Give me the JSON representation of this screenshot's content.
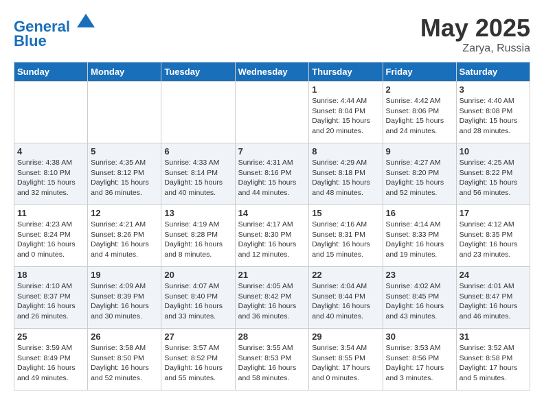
{
  "header": {
    "logo_line1": "General",
    "logo_line2": "Blue",
    "month_year": "May 2025",
    "location": "Zarya, Russia"
  },
  "weekdays": [
    "Sunday",
    "Monday",
    "Tuesday",
    "Wednesday",
    "Thursday",
    "Friday",
    "Saturday"
  ],
  "weeks": [
    [
      {
        "num": "",
        "info": ""
      },
      {
        "num": "",
        "info": ""
      },
      {
        "num": "",
        "info": ""
      },
      {
        "num": "",
        "info": ""
      },
      {
        "num": "1",
        "info": "Sunrise: 4:44 AM\nSunset: 8:04 PM\nDaylight: 15 hours\nand 20 minutes."
      },
      {
        "num": "2",
        "info": "Sunrise: 4:42 AM\nSunset: 8:06 PM\nDaylight: 15 hours\nand 24 minutes."
      },
      {
        "num": "3",
        "info": "Sunrise: 4:40 AM\nSunset: 8:08 PM\nDaylight: 15 hours\nand 28 minutes."
      }
    ],
    [
      {
        "num": "4",
        "info": "Sunrise: 4:38 AM\nSunset: 8:10 PM\nDaylight: 15 hours\nand 32 minutes."
      },
      {
        "num": "5",
        "info": "Sunrise: 4:35 AM\nSunset: 8:12 PM\nDaylight: 15 hours\nand 36 minutes."
      },
      {
        "num": "6",
        "info": "Sunrise: 4:33 AM\nSunset: 8:14 PM\nDaylight: 15 hours\nand 40 minutes."
      },
      {
        "num": "7",
        "info": "Sunrise: 4:31 AM\nSunset: 8:16 PM\nDaylight: 15 hours\nand 44 minutes."
      },
      {
        "num": "8",
        "info": "Sunrise: 4:29 AM\nSunset: 8:18 PM\nDaylight: 15 hours\nand 48 minutes."
      },
      {
        "num": "9",
        "info": "Sunrise: 4:27 AM\nSunset: 8:20 PM\nDaylight: 15 hours\nand 52 minutes."
      },
      {
        "num": "10",
        "info": "Sunrise: 4:25 AM\nSunset: 8:22 PM\nDaylight: 15 hours\nand 56 minutes."
      }
    ],
    [
      {
        "num": "11",
        "info": "Sunrise: 4:23 AM\nSunset: 8:24 PM\nDaylight: 16 hours\nand 0 minutes."
      },
      {
        "num": "12",
        "info": "Sunrise: 4:21 AM\nSunset: 8:26 PM\nDaylight: 16 hours\nand 4 minutes."
      },
      {
        "num": "13",
        "info": "Sunrise: 4:19 AM\nSunset: 8:28 PM\nDaylight: 16 hours\nand 8 minutes."
      },
      {
        "num": "14",
        "info": "Sunrise: 4:17 AM\nSunset: 8:30 PM\nDaylight: 16 hours\nand 12 minutes."
      },
      {
        "num": "15",
        "info": "Sunrise: 4:16 AM\nSunset: 8:31 PM\nDaylight: 16 hours\nand 15 minutes."
      },
      {
        "num": "16",
        "info": "Sunrise: 4:14 AM\nSunset: 8:33 PM\nDaylight: 16 hours\nand 19 minutes."
      },
      {
        "num": "17",
        "info": "Sunrise: 4:12 AM\nSunset: 8:35 PM\nDaylight: 16 hours\nand 23 minutes."
      }
    ],
    [
      {
        "num": "18",
        "info": "Sunrise: 4:10 AM\nSunset: 8:37 PM\nDaylight: 16 hours\nand 26 minutes."
      },
      {
        "num": "19",
        "info": "Sunrise: 4:09 AM\nSunset: 8:39 PM\nDaylight: 16 hours\nand 30 minutes."
      },
      {
        "num": "20",
        "info": "Sunrise: 4:07 AM\nSunset: 8:40 PM\nDaylight: 16 hours\nand 33 minutes."
      },
      {
        "num": "21",
        "info": "Sunrise: 4:05 AM\nSunset: 8:42 PM\nDaylight: 16 hours\nand 36 minutes."
      },
      {
        "num": "22",
        "info": "Sunrise: 4:04 AM\nSunset: 8:44 PM\nDaylight: 16 hours\nand 40 minutes."
      },
      {
        "num": "23",
        "info": "Sunrise: 4:02 AM\nSunset: 8:45 PM\nDaylight: 16 hours\nand 43 minutes."
      },
      {
        "num": "24",
        "info": "Sunrise: 4:01 AM\nSunset: 8:47 PM\nDaylight: 16 hours\nand 46 minutes."
      }
    ],
    [
      {
        "num": "25",
        "info": "Sunrise: 3:59 AM\nSunset: 8:49 PM\nDaylight: 16 hours\nand 49 minutes."
      },
      {
        "num": "26",
        "info": "Sunrise: 3:58 AM\nSunset: 8:50 PM\nDaylight: 16 hours\nand 52 minutes."
      },
      {
        "num": "27",
        "info": "Sunrise: 3:57 AM\nSunset: 8:52 PM\nDaylight: 16 hours\nand 55 minutes."
      },
      {
        "num": "28",
        "info": "Sunrise: 3:55 AM\nSunset: 8:53 PM\nDaylight: 16 hours\nand 58 minutes."
      },
      {
        "num": "29",
        "info": "Sunrise: 3:54 AM\nSunset: 8:55 PM\nDaylight: 17 hours\nand 0 minutes."
      },
      {
        "num": "30",
        "info": "Sunrise: 3:53 AM\nSunset: 8:56 PM\nDaylight: 17 hours\nand 3 minutes."
      },
      {
        "num": "31",
        "info": "Sunrise: 3:52 AM\nSunset: 8:58 PM\nDaylight: 17 hours\nand 5 minutes."
      }
    ]
  ]
}
